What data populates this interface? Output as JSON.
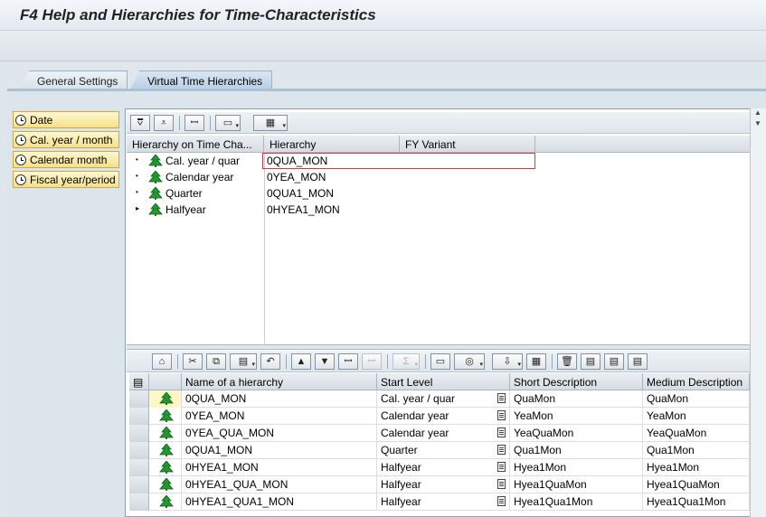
{
  "window": {
    "title": "F4 Help and Hierarchies for Time-Characteristics"
  },
  "tabs": [
    {
      "label": "General Settings",
      "active": false
    },
    {
      "label": "Virtual Time Hierarchies",
      "active": true
    }
  ],
  "left_nav": {
    "items": [
      {
        "label": "Date",
        "icon": "clock-icon"
      },
      {
        "label": "Cal. year / month",
        "icon": "clock-icon"
      },
      {
        "label": "Calendar month",
        "icon": "clock-icon"
      },
      {
        "label": "Fiscal year/period",
        "icon": "clock-icon"
      }
    ]
  },
  "tree": {
    "columns": [
      "Hierarchy on Time Cha...",
      "Hierarchy",
      "FY Variant"
    ],
    "rows": [
      {
        "label": "Cal. year / quar",
        "hierarchy": "0QUA_MON",
        "expander": "•",
        "selected": true
      },
      {
        "label": "Calendar year",
        "hierarchy": "0YEA_MON",
        "expander": "•",
        "selected": false
      },
      {
        "label": "Quarter",
        "hierarchy": "0QUA1_MON",
        "expander": "•",
        "selected": false
      },
      {
        "label": "Halfyear",
        "hierarchy": "0HYEA1_MON",
        "expander": "▸",
        "selected": false
      }
    ]
  },
  "grid": {
    "columns": [
      "Name of a hierarchy",
      "Start Level",
      "Short Description",
      "Medium Description"
    ],
    "rows": [
      {
        "name": "0QUA_MON",
        "level": "Cal. year / quar",
        "short": "QuaMon",
        "medium": "QuaMon"
      },
      {
        "name": "0YEA_MON",
        "level": "Calendar year",
        "short": "YeaMon",
        "medium": "YeaMon"
      },
      {
        "name": "0YEA_QUA_MON",
        "level": "Calendar year",
        "short": "YeaQuaMon",
        "medium": "YeaQuaMon"
      },
      {
        "name": "0QUA1_MON",
        "level": "Quarter",
        "short": "Qua1Mon",
        "medium": "Qua1Mon"
      },
      {
        "name": "0HYEA1_MON",
        "level": "Halfyear",
        "short": "Hyea1Mon",
        "medium": "Hyea1Mon"
      },
      {
        "name": "0HYEA1_QUA_MON",
        "level": "Halfyear",
        "short": "Hyea1QuaMon",
        "medium": "Hyea1QuaMon"
      },
      {
        "name": "0HYEA1_QUA1_MON",
        "level": "Halfyear",
        "short": "Hyea1Qua1Mon",
        "medium": "Hyea1Qua1Mon"
      }
    ]
  },
  "colors": {
    "accent": "#f5e08a",
    "selection_border": "#d43a3a",
    "tree_icon": "#1f9a2e"
  }
}
